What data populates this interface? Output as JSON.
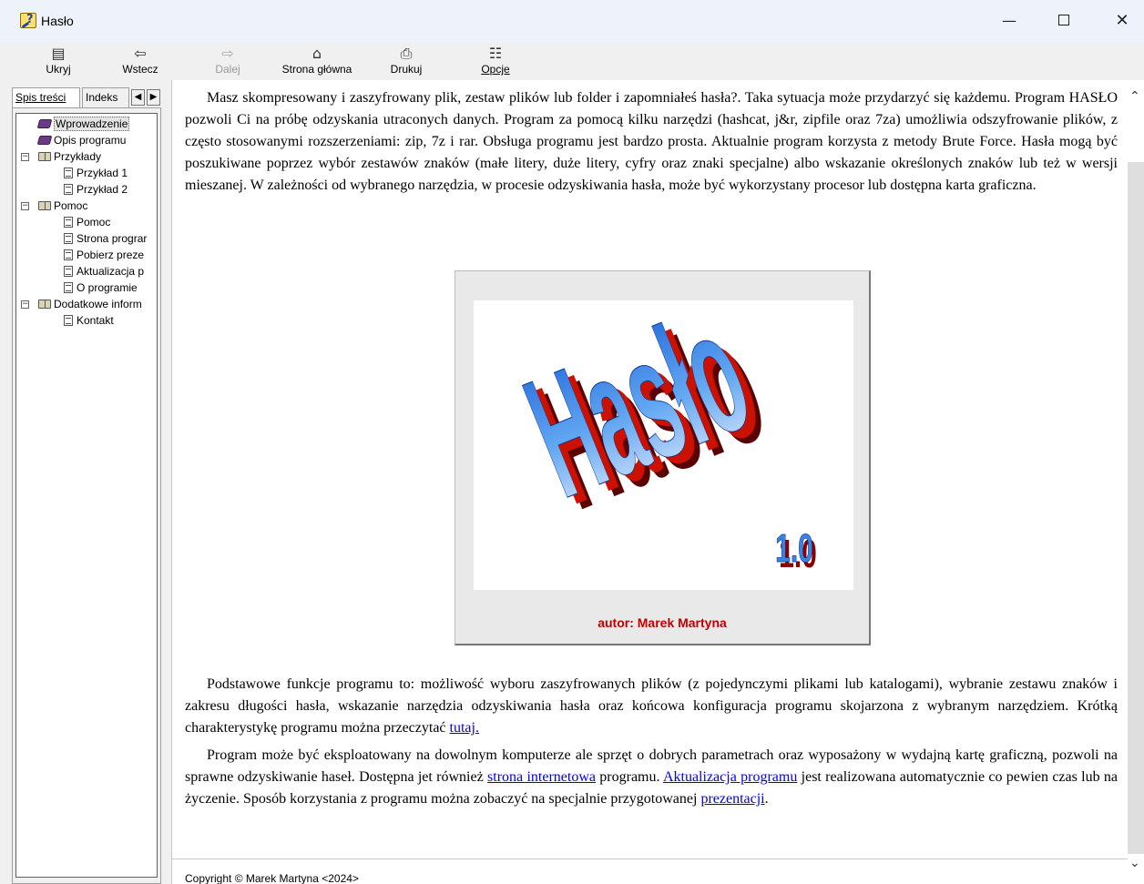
{
  "window": {
    "title": "Hasło",
    "minimize_glyph": "—",
    "close_glyph": "✕"
  },
  "toolbar": {
    "items": [
      {
        "label": "Ukryj",
        "icon": "hide-pane-icon",
        "glyph": "▤"
      },
      {
        "label": "Wstecz",
        "icon": "back-arrow-icon",
        "glyph": "⇦"
      },
      {
        "label": "Dalej",
        "icon": "forward-arrow-icon",
        "glyph": "⇨"
      },
      {
        "label": "Strona główna",
        "icon": "home-icon",
        "glyph": "⌂"
      },
      {
        "label": "Drukuj",
        "icon": "printer-icon",
        "glyph": "⎙"
      },
      {
        "label": "Opcje",
        "icon": "options-icon",
        "glyph": "☷"
      }
    ]
  },
  "nav": {
    "tabs": [
      "Spis treści",
      "Indeks"
    ],
    "spin_left": "◀",
    "spin_right": "▶",
    "tree": [
      {
        "label": "Wprowadzenie",
        "icon": "book-closed-icon"
      },
      {
        "label": "Opis programu",
        "icon": "book-closed-icon"
      },
      {
        "label": "Przykłady",
        "icon": "book-open-icon",
        "expander": "−"
      },
      {
        "label": "Przykład 1",
        "icon": "page-icon"
      },
      {
        "label": "Przykład 2",
        "icon": "page-icon"
      },
      {
        "label": "Pomoc",
        "icon": "book-open-icon",
        "expander": "−"
      },
      {
        "label": "Pomoc",
        "icon": "page-icon"
      },
      {
        "label": "Strona prograr",
        "icon": "page-icon"
      },
      {
        "label": "Pobierz preze",
        "icon": "page-icon"
      },
      {
        "label": "Aktualizacja p",
        "icon": "page-icon"
      },
      {
        "label": "O programie",
        "icon": "page-icon"
      },
      {
        "label": "Dodatkowe inform",
        "icon": "book-open-icon",
        "expander": "−"
      },
      {
        "label": "Kontakt",
        "icon": "page-icon"
      }
    ]
  },
  "content": {
    "intro": "Masz skompresowany i zaszyfrowany plik, zestaw plików lub folder i zapomniałeś hasła?. Taka sytuacja może przydarzyć się każdemu. Program HASŁO pozwoli Ci na próbę odzyskania utraconych danych. Program za pomocą kilku narzędzi (hashcat, j&r, zipfile oraz 7za) umożliwia odszyfrowanie plików, z często stosowanymi rozszerzeniami: zip, 7z i rar. Obsługa programu jest bardzo prosta. Aktualnie program korzysta z metody Brute Force. Hasła mogą być poszukiwane poprzez wybór zestawów znaków (małe litery, duże litery, cyfry oraz znaki specjalne) albo wskazanie określonych znaków lub też w wersji mieszanej. W zależności od wybranego narzędzia, w procesie odzyskiwania hasła, może być wykorzystany procesor lub dostępna karta graficzna.",
    "logo": {
      "title": "Hasło",
      "version": "1.0",
      "author": "autor:  Marek Martyna"
    },
    "para2_text": "Podstawowe funkcje programu to: możliwość wyboru zaszyfrowanych plików (z pojedynczymi plikami lub katalogami), wybranie zestawu znaków i zakresu długości hasła, wskazanie narzędzia odzyskiwania hasła oraz końcowa konfiguracja programu skojarzona z wybranym narzędziem. Krótką charakterystykę programu można przeczytać ",
    "para2_link": "tutaj.",
    "para3_a": "Program może być eksploatowany na dowolnym komputerze ale sprzęt o dobrych parametrach oraz wyposażony w wydajną kartę graficzną, pozwoli na sprawne odzyskiwanie haseł. Dostępna jet również ",
    "para3_link1": "strona internetowa",
    "para3_b": " programu. ",
    "para3_link2": "Aktualizacja programu",
    "para3_c": " jest realizowana automatycznie co pewien czas lub na życzenie. Sposób korzystania z programu można zobaczyć na specjalnie przygotowanej ",
    "para3_link3": "prezentacji",
    "para3_d": ".",
    "copyright": "Copyright © Marek Martyna <2024>"
  },
  "scrollbar": {
    "up": "⌃",
    "down": "⌄"
  },
  "colors": {
    "logo_blue_top": "#1a5fd8",
    "logo_blue_bottom": "#e9eefc",
    "logo_red": "#cc1100",
    "author_red": "#c00000",
    "link": "#0000ee"
  }
}
